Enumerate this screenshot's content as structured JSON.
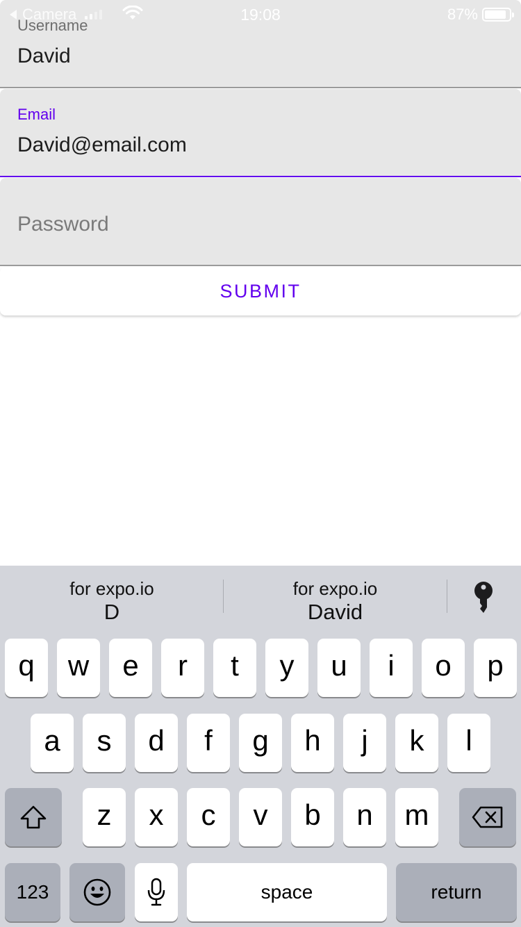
{
  "status_bar": {
    "back_label": "Camera",
    "time": "19:08",
    "battery": "87%",
    "battery_level": 0.87
  },
  "form": {
    "username": {
      "label": "Username",
      "value": "David"
    },
    "email": {
      "label": "Email",
      "value": "David@email.com"
    },
    "password": {
      "placeholder": "Password"
    },
    "submit_label": "SUBMIT"
  },
  "keyboard": {
    "suggestions": [
      {
        "sub": "for expo.io",
        "main": "D"
      },
      {
        "sub": "for expo.io",
        "main": "David"
      }
    ],
    "password_icon": "key-icon",
    "row1": [
      "q",
      "w",
      "e",
      "r",
      "t",
      "y",
      "u",
      "i",
      "o",
      "p"
    ],
    "row2": [
      "a",
      "s",
      "d",
      "f",
      "g",
      "h",
      "j",
      "k",
      "l"
    ],
    "row3": [
      "z",
      "x",
      "c",
      "v",
      "b",
      "n",
      "m"
    ],
    "numbers_label": "123",
    "space_label": "space",
    "return_label": "return",
    "icons": {
      "shift": "shift-icon",
      "delete": "delete-icon",
      "emoji": "emoji-icon",
      "mic": "microphone-icon"
    }
  }
}
